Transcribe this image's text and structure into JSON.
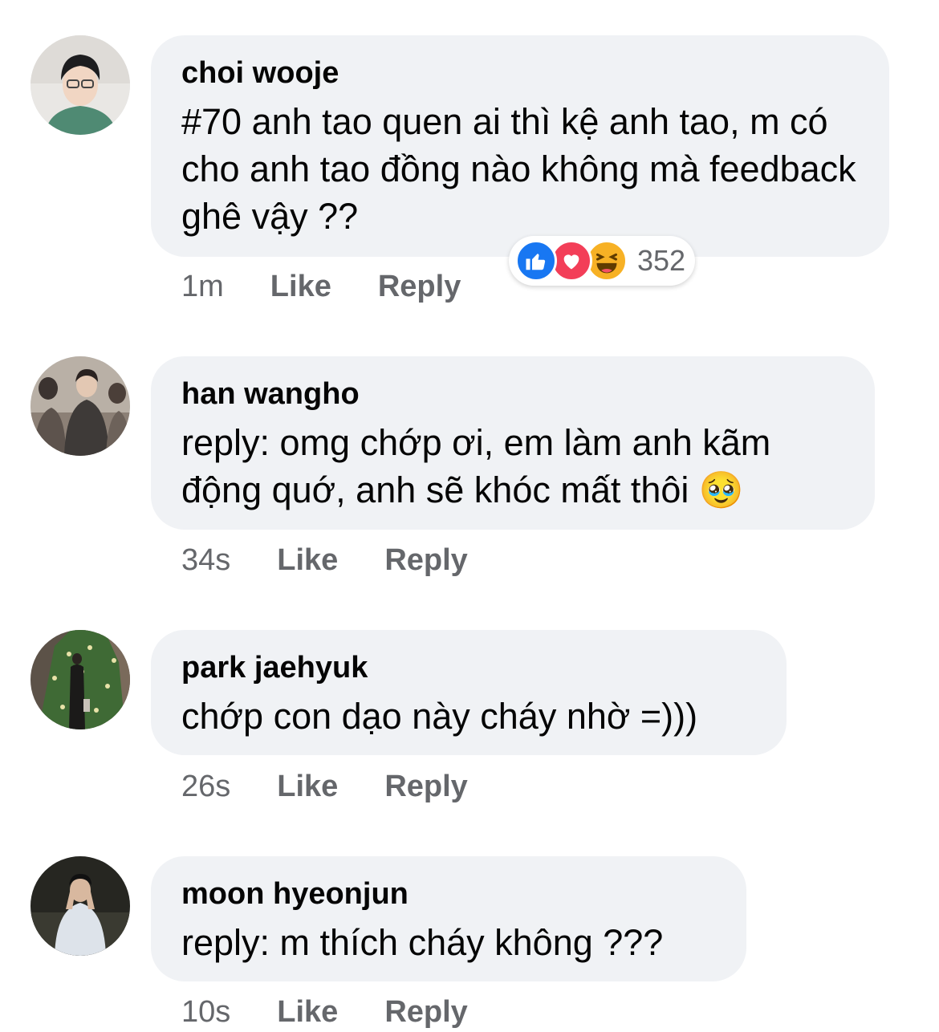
{
  "comments": [
    {
      "author": "choi wooje",
      "text": "#70 anh tao quen ai thì kệ anh tao, m có cho anh tao đồng nào không mà feedback ghê vậy ??",
      "time": "1m",
      "like_label": "Like",
      "reply_label": "Reply",
      "reactions": {
        "count": "352",
        "icons": [
          "like-icon",
          "love-icon",
          "haha-icon"
        ]
      }
    },
    {
      "author": "han wangho",
      "text": "reply: omg chớp ơi, em làm anh kãm động quớ, anh sẽ khóc mất thôi 🥹",
      "time": "34s",
      "like_label": "Like",
      "reply_label": "Reply"
    },
    {
      "author": "park jaehyuk",
      "text": "chớp con dạo này cháy nhờ =)))",
      "time": "26s",
      "like_label": "Like",
      "reply_label": "Reply"
    },
    {
      "author": "moon hyeonjun",
      "text": "reply: m thích cháy không ???",
      "time": "10s",
      "like_label": "Like",
      "reply_label": "Reply"
    }
  ],
  "colors": {
    "bubble": "#f0f2f5",
    "meta_text": "#65676b",
    "like": "#1877f2",
    "love": "#f33e58",
    "haha": "#f7b125"
  }
}
